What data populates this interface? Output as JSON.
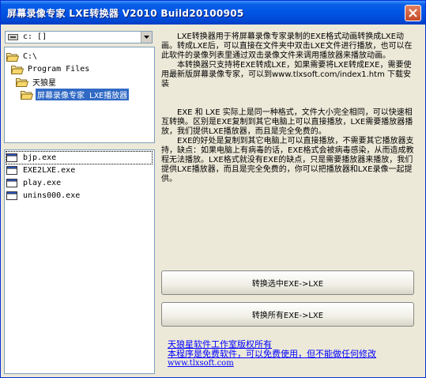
{
  "window": {
    "title": "屏幕录像专家 LXE转换器 V2010 Build20100905"
  },
  "drive_select": {
    "value": "c: []"
  },
  "directories": [
    {
      "label": "C:\\",
      "selected": false
    },
    {
      "label": "Program Files",
      "selected": false
    },
    {
      "label": "天狼星",
      "selected": false
    },
    {
      "label": "屏幕录像专家 LXE播放器",
      "selected": true
    }
  ],
  "files": [
    {
      "label": "bjp.exe"
    },
    {
      "label": "EXE2LXE.exe"
    },
    {
      "label": "play.exe"
    },
    {
      "label": "unins000.exe"
    }
  ],
  "description": {
    "p1": "LXE转换器用于将屏幕录像专家录制的EXE格式动画转换成LXE动画。转成LXE后，可以直接在文件夹中双击LXE文件进行播放，也可以在此软件的录像列表里通过双击录像文件来调用播放器来播放动画。",
    "p2": "本转换器只支持将EXE转成LXE，如果需要将LXE转成EXE，需要使用最新版屏幕录像专家，可以到www.tlxsoft.com/index1.htm 下载安装",
    "p3": "EXE 和 LXE 实际上是同一种格式，文件大小完全相同，可以快速相互转换。区别是EXE复制到其它电脑上可以直接播放，LXE需要播放器播放，我们提供LXE播放器，而且是完全免费的。",
    "p4": "EXE的好处是复制到其它电脑上可以直接播放，不需要其它播放器支持，缺点：如果电脑上有病毒的话，EXE格式会被病毒感染，从而造成教程无法播放。LXE格式就没有EXE的缺点，只是需要播放器来播放，我们提供LXE播放器，而且是完全免费的，你可以把播放器和LXE录像一起提供。"
  },
  "buttons": {
    "convert_selected": "转换选中EXE->LXE",
    "convert_all": "转换所有EXE->LXE"
  },
  "footer": {
    "copyright": "天狼星软件工作室版权所有",
    "free_notice": "本程序是免费软件，可以免费使用，但不能做任何修改",
    "url": "www.tlxsoft.com"
  },
  "colors": {
    "titlebar": "#0055e5",
    "selection": "#316ac5",
    "link": "#0000ff"
  }
}
